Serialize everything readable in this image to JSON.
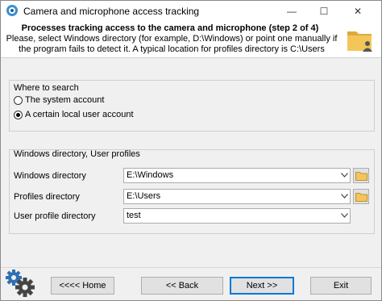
{
  "window": {
    "title": "Camera and microphone access tracking",
    "minimize_symbol": "—",
    "maximize_symbol": "☐",
    "close_symbol": "✕"
  },
  "header": {
    "title": "Processes tracking access to the camera and microphone (step 2 of 4)",
    "description": "Please, select Windows directory (for example, D:\\Windows) or point one manually if the program fails to detect it. A typical location for profiles directory is C:\\Users",
    "icon": "folder-user-icon"
  },
  "search": {
    "group_title": "Where to search",
    "options": [
      {
        "label": "The system account",
        "selected": false
      },
      {
        "label": "A certain local user account",
        "selected": true
      }
    ]
  },
  "dirs": {
    "group_title": "Windows directory, User profiles",
    "windows": {
      "label": "Windows directory",
      "value": "E:\\Windows"
    },
    "profiles": {
      "label": "Profiles directory",
      "value": "E:\\Users"
    },
    "user_profile": {
      "label": "User profile directory",
      "value": "test"
    }
  },
  "footer": {
    "home": "<<<< Home",
    "back": "<< Back",
    "next": "Next >>",
    "exit": "Exit",
    "icon": "gears-icon"
  },
  "colors": {
    "accent": "#0078d7",
    "folder": "#e8b84a",
    "window_bg": "#f0f0f0"
  }
}
